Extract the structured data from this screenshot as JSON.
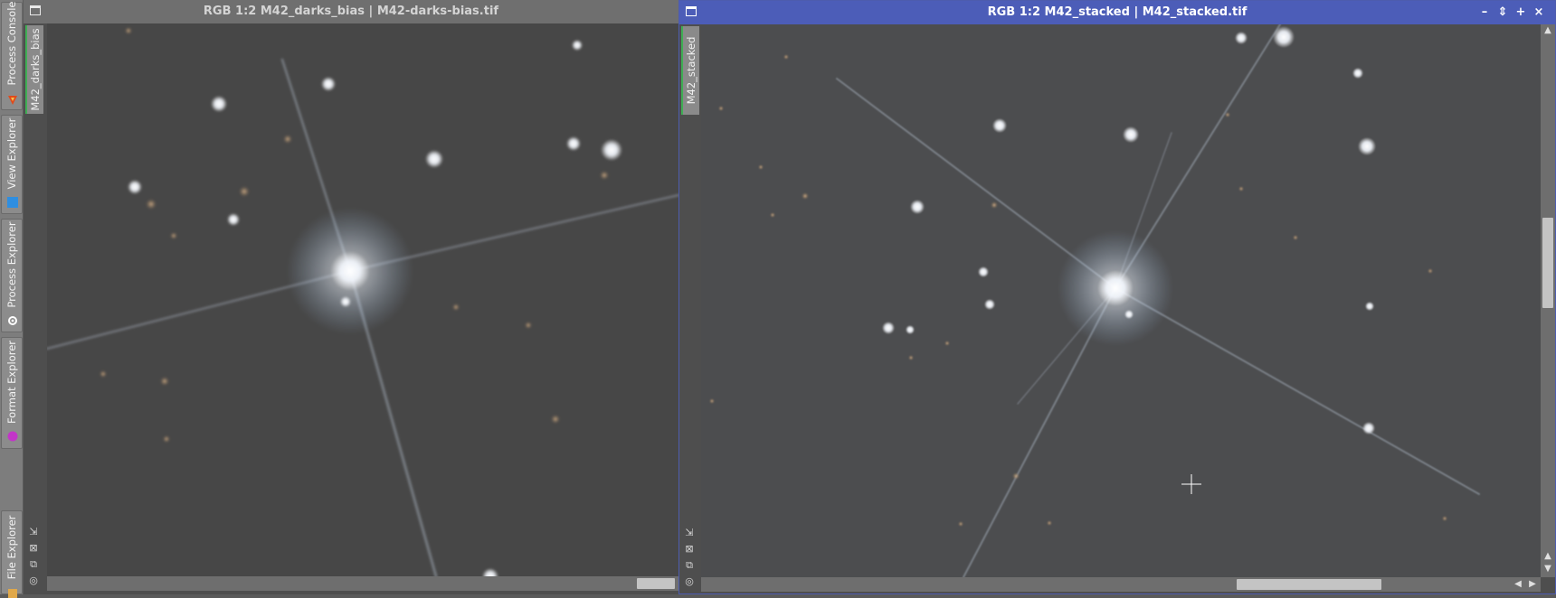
{
  "sidebar": {
    "tabs": [
      {
        "label": "Process Console",
        "icon": "process-console-icon"
      },
      {
        "label": "View Explorer",
        "icon": "view-explorer-icon"
      },
      {
        "label": "Process Explorer",
        "icon": "gear-icon"
      },
      {
        "label": "Format Explorer",
        "icon": "format-explorer-icon"
      },
      {
        "label": "File Explorer",
        "icon": "file-explorer-icon"
      }
    ]
  },
  "left_window": {
    "title": "RGB 1:2 M42_darks_bias | M42-darks-bias.tif",
    "view_tab": "M42_darks_bias",
    "image": "star field with bright diffraction-spiked star, slightly blurred"
  },
  "right_window": {
    "title": "RGB 1:2 M42_stacked | M42_stacked.tif",
    "view_tab": "M42_stacked",
    "controls": [
      "–",
      "⇕",
      "+",
      "×"
    ],
    "accent": "#4c5db8",
    "image": "star field with bright diffraction-spiked star, stacked"
  },
  "colors": {
    "title_active": "#4c5db8",
    "title_inactive": "#6f6f6f",
    "view_tab_marker": "#3fae54",
    "sky_background": "#4a4a4a"
  }
}
